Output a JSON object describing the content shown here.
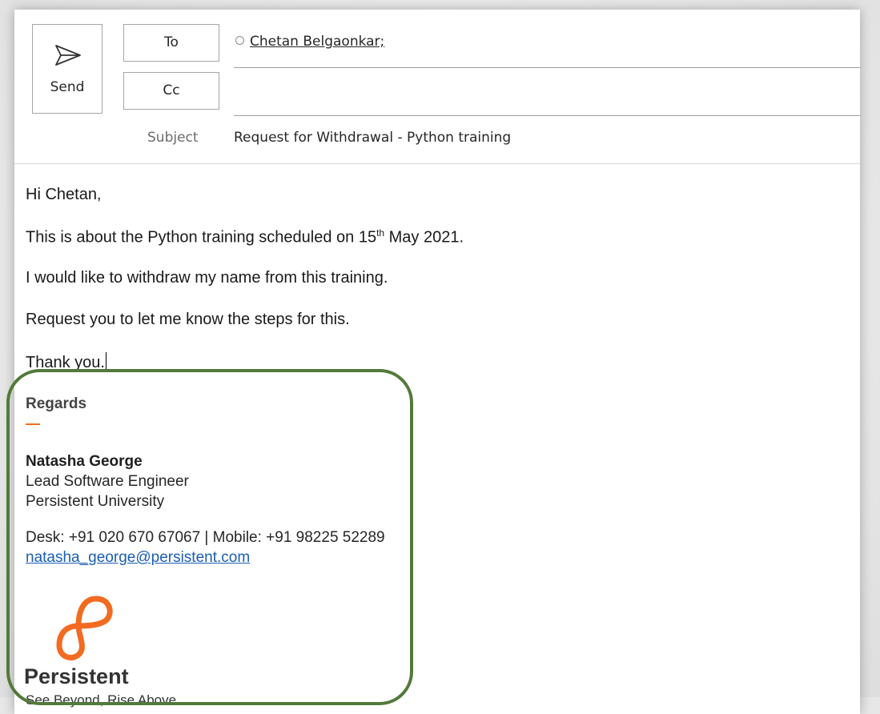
{
  "toolbar": {
    "send_label": "Send",
    "to_label": "To",
    "cc_label": "Cc"
  },
  "header": {
    "to_recipients": [
      "Chetan Belgaonkar;"
    ],
    "cc_recipients": [],
    "subject_label": "Subject",
    "subject_value": "Request for Withdrawal - Python training"
  },
  "body": {
    "greeting": "Hi Chetan,",
    "line1_before": "This is about the Python training scheduled on 15",
    "line1_sup": "th",
    "line1_after": " May 2021.",
    "line2": "I would like to withdraw my name from this training.",
    "line3": "Request you to let me know the steps for this.",
    "closing": "Thank you."
  },
  "signature": {
    "regards": "Regards",
    "name": "Natasha George",
    "title": "Lead Software Engineer",
    "organization": "Persistent University",
    "phone": "Desk: +91 020 670 67067 | Mobile: +91 98225 52289",
    "email": "natasha_george@persistent.com",
    "logo_text": "Persistent",
    "logo_tagline_partial": "See Beyond, Rise Above"
  },
  "icons": {
    "send": "paper-plane-icon",
    "presence": "presence-status-icon",
    "logo": "persistent-logo-icon"
  },
  "colors": {
    "signature_highlight": "#527a3a",
    "brand_orange": "#f26b21",
    "link_blue": "#1a5fb4"
  }
}
